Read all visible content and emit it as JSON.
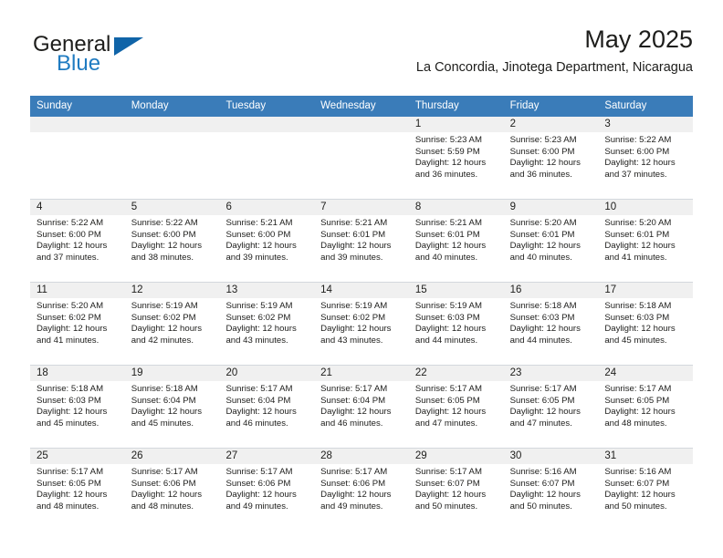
{
  "brand": {
    "word_one": "General",
    "word_two": "Blue",
    "triangle_color": "#1064a8",
    "blue_color": "#1f7bc1"
  },
  "header": {
    "title": "May 2025",
    "subtitle": "La Concordia, Jinotega Department, Nicaragua"
  },
  "calendar": {
    "header_bg": "#3a7cb9",
    "shaded_cell_bg": "#f0f0f0",
    "weekdays": [
      "Sunday",
      "Monday",
      "Tuesday",
      "Wednesday",
      "Thursday",
      "Friday",
      "Saturday"
    ],
    "weeks": [
      [
        {
          "day": "",
          "lines": []
        },
        {
          "day": "",
          "lines": []
        },
        {
          "day": "",
          "lines": []
        },
        {
          "day": "",
          "lines": []
        },
        {
          "day": "1",
          "lines": [
            "Sunrise: 5:23 AM",
            "Sunset: 5:59 PM",
            "Daylight: 12 hours",
            "and 36 minutes."
          ]
        },
        {
          "day": "2",
          "lines": [
            "Sunrise: 5:23 AM",
            "Sunset: 6:00 PM",
            "Daylight: 12 hours",
            "and 36 minutes."
          ]
        },
        {
          "day": "3",
          "lines": [
            "Sunrise: 5:22 AM",
            "Sunset: 6:00 PM",
            "Daylight: 12 hours",
            "and 37 minutes."
          ]
        }
      ],
      [
        {
          "day": "4",
          "lines": [
            "Sunrise: 5:22 AM",
            "Sunset: 6:00 PM",
            "Daylight: 12 hours",
            "and 37 minutes."
          ]
        },
        {
          "day": "5",
          "lines": [
            "Sunrise: 5:22 AM",
            "Sunset: 6:00 PM",
            "Daylight: 12 hours",
            "and 38 minutes."
          ]
        },
        {
          "day": "6",
          "lines": [
            "Sunrise: 5:21 AM",
            "Sunset: 6:00 PM",
            "Daylight: 12 hours",
            "and 39 minutes."
          ]
        },
        {
          "day": "7",
          "lines": [
            "Sunrise: 5:21 AM",
            "Sunset: 6:01 PM",
            "Daylight: 12 hours",
            "and 39 minutes."
          ]
        },
        {
          "day": "8",
          "lines": [
            "Sunrise: 5:21 AM",
            "Sunset: 6:01 PM",
            "Daylight: 12 hours",
            "and 40 minutes."
          ]
        },
        {
          "day": "9",
          "lines": [
            "Sunrise: 5:20 AM",
            "Sunset: 6:01 PM",
            "Daylight: 12 hours",
            "and 40 minutes."
          ]
        },
        {
          "day": "10",
          "lines": [
            "Sunrise: 5:20 AM",
            "Sunset: 6:01 PM",
            "Daylight: 12 hours",
            "and 41 minutes."
          ]
        }
      ],
      [
        {
          "day": "11",
          "lines": [
            "Sunrise: 5:20 AM",
            "Sunset: 6:02 PM",
            "Daylight: 12 hours",
            "and 41 minutes."
          ]
        },
        {
          "day": "12",
          "lines": [
            "Sunrise: 5:19 AM",
            "Sunset: 6:02 PM",
            "Daylight: 12 hours",
            "and 42 minutes."
          ]
        },
        {
          "day": "13",
          "lines": [
            "Sunrise: 5:19 AM",
            "Sunset: 6:02 PM",
            "Daylight: 12 hours",
            "and 43 minutes."
          ]
        },
        {
          "day": "14",
          "lines": [
            "Sunrise: 5:19 AM",
            "Sunset: 6:02 PM",
            "Daylight: 12 hours",
            "and 43 minutes."
          ]
        },
        {
          "day": "15",
          "lines": [
            "Sunrise: 5:19 AM",
            "Sunset: 6:03 PM",
            "Daylight: 12 hours",
            "and 44 minutes."
          ]
        },
        {
          "day": "16",
          "lines": [
            "Sunrise: 5:18 AM",
            "Sunset: 6:03 PM",
            "Daylight: 12 hours",
            "and 44 minutes."
          ]
        },
        {
          "day": "17",
          "lines": [
            "Sunrise: 5:18 AM",
            "Sunset: 6:03 PM",
            "Daylight: 12 hours",
            "and 45 minutes."
          ]
        }
      ],
      [
        {
          "day": "18",
          "lines": [
            "Sunrise: 5:18 AM",
            "Sunset: 6:03 PM",
            "Daylight: 12 hours",
            "and 45 minutes."
          ]
        },
        {
          "day": "19",
          "lines": [
            "Sunrise: 5:18 AM",
            "Sunset: 6:04 PM",
            "Daylight: 12 hours",
            "and 45 minutes."
          ]
        },
        {
          "day": "20",
          "lines": [
            "Sunrise: 5:17 AM",
            "Sunset: 6:04 PM",
            "Daylight: 12 hours",
            "and 46 minutes."
          ]
        },
        {
          "day": "21",
          "lines": [
            "Sunrise: 5:17 AM",
            "Sunset: 6:04 PM",
            "Daylight: 12 hours",
            "and 46 minutes."
          ]
        },
        {
          "day": "22",
          "lines": [
            "Sunrise: 5:17 AM",
            "Sunset: 6:05 PM",
            "Daylight: 12 hours",
            "and 47 minutes."
          ]
        },
        {
          "day": "23",
          "lines": [
            "Sunrise: 5:17 AM",
            "Sunset: 6:05 PM",
            "Daylight: 12 hours",
            "and 47 minutes."
          ]
        },
        {
          "day": "24",
          "lines": [
            "Sunrise: 5:17 AM",
            "Sunset: 6:05 PM",
            "Daylight: 12 hours",
            "and 48 minutes."
          ]
        }
      ],
      [
        {
          "day": "25",
          "lines": [
            "Sunrise: 5:17 AM",
            "Sunset: 6:05 PM",
            "Daylight: 12 hours",
            "and 48 minutes."
          ]
        },
        {
          "day": "26",
          "lines": [
            "Sunrise: 5:17 AM",
            "Sunset: 6:06 PM",
            "Daylight: 12 hours",
            "and 48 minutes."
          ]
        },
        {
          "day": "27",
          "lines": [
            "Sunrise: 5:17 AM",
            "Sunset: 6:06 PM",
            "Daylight: 12 hours",
            "and 49 minutes."
          ]
        },
        {
          "day": "28",
          "lines": [
            "Sunrise: 5:17 AM",
            "Sunset: 6:06 PM",
            "Daylight: 12 hours",
            "and 49 minutes."
          ]
        },
        {
          "day": "29",
          "lines": [
            "Sunrise: 5:17 AM",
            "Sunset: 6:07 PM",
            "Daylight: 12 hours",
            "and 50 minutes."
          ]
        },
        {
          "day": "30",
          "lines": [
            "Sunrise: 5:16 AM",
            "Sunset: 6:07 PM",
            "Daylight: 12 hours",
            "and 50 minutes."
          ]
        },
        {
          "day": "31",
          "lines": [
            "Sunrise: 5:16 AM",
            "Sunset: 6:07 PM",
            "Daylight: 12 hours",
            "and 50 minutes."
          ]
        }
      ]
    ]
  }
}
